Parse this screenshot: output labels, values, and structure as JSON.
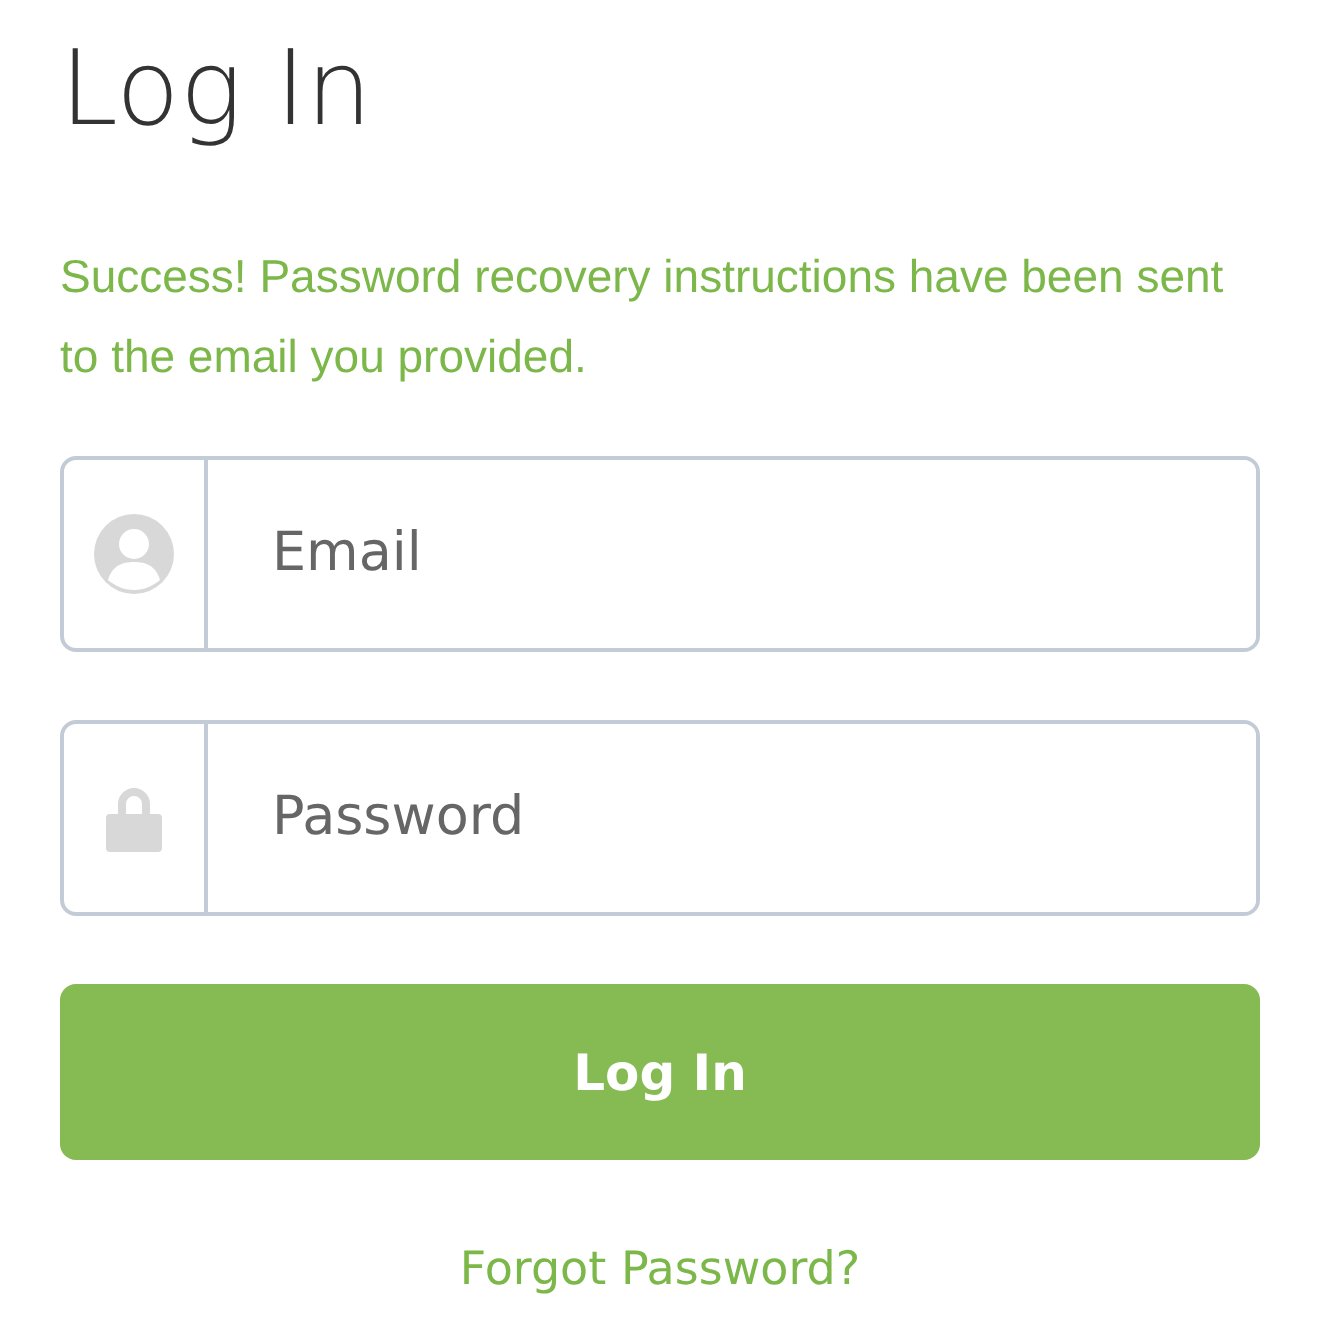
{
  "title": "Log In",
  "message": "Success! Password recovery instructions have been sent to the email you provided.",
  "fields": [
    {
      "kind": "email",
      "placeholder": "Email"
    },
    {
      "kind": "password",
      "placeholder": "Password"
    }
  ],
  "submit": "Log In",
  "forgot_link": "Forgot Password?"
}
